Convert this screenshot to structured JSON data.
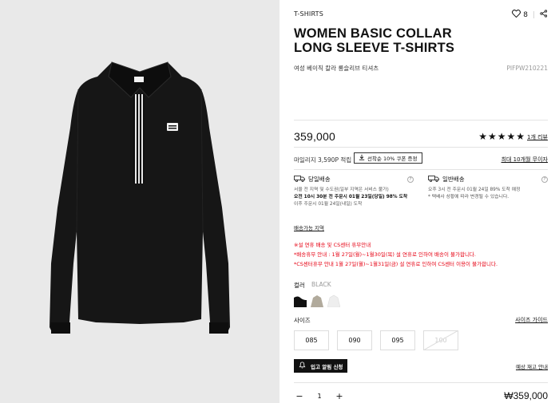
{
  "product": {
    "category": "T-SHIRTS",
    "wishlist_count": "8",
    "title_line1": "WOMEN BASIC COLLAR",
    "title_line2": "LONG SLEEVE T-SHIRTS",
    "korean_name": "여성 베이직 칼라 롱슬리브 티셔츠",
    "code": "PIFPW210221",
    "price": "359,000",
    "rating": 5,
    "stars": "★★★★★",
    "review_link": "1개 리뷰"
  },
  "mileage": {
    "text": "마일리지 3,590P 적립",
    "coupon_button": "선착순 10% 쿠폰 증정",
    "discount_link": "최대 10개월 무이자"
  },
  "shipping": {
    "same_day": {
      "title": "당일배송",
      "lines": [
        "서울 전 지역 및 수도권(일부 지역은 서비스 불가)",
        "오전 10시 30분 전 주문시 01월 23일(당일) 98% 도착",
        "이후 주문시 01월 24일(내일) 도착"
      ]
    },
    "general": {
      "title": "일반배송",
      "lines": [
        "오후 3시 전 주문시 01월 24일 89% 도착 예정",
        "* 택배사 상황에 따라 변경될 수 있습니다."
      ]
    },
    "area_link": "배송가능 지역"
  },
  "notice": {
    "lines": [
      "※설 연휴 배송 및 CS센터 휴무안내",
      "*배송휴무 안내 : 1월 27일(월)~1월30일(목) 설 연휴로 인하여 배송이 불가합니다.",
      "*CS센터휴무 안내 1월 27일(월)~1월31일(금) 설 연휴로 인하여 CS센터 이용이 불가합니다."
    ]
  },
  "options": {
    "color_label": "컬러",
    "color_selected": "BLACK",
    "colors": [
      "#111111",
      "#b1aa9c",
      "#eeeeee"
    ],
    "size_label": "사이즈",
    "size_guide": "사이즈 가이드",
    "sizes": [
      "085",
      "090",
      "095",
      "100"
    ],
    "sold_out_size": "100"
  },
  "restock": {
    "button": "입고 알림 신청",
    "link": "예상 재고 안내"
  },
  "order": {
    "minus": "−",
    "plus": "+",
    "quantity": "1",
    "total": "₩359,000"
  },
  "icons": {
    "wishlist": "heart-icon",
    "share": "share-icon",
    "download": "download-icon",
    "same_day_truck": "truck-icon",
    "general_truck": "truck-icon",
    "help": "help-icon",
    "bell": "bell-icon"
  }
}
